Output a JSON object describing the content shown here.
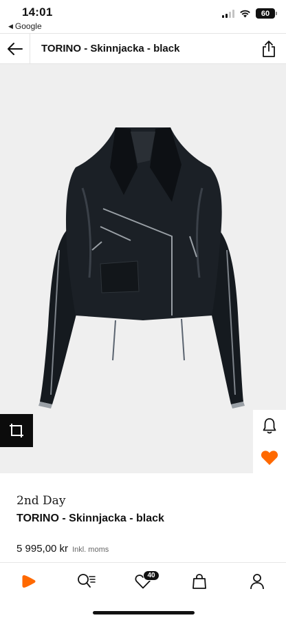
{
  "status_bar": {
    "time": "14:01",
    "back_app": "Google",
    "battery": "60"
  },
  "header": {
    "title": "TORINO - Skinnjacka - black",
    "back_icon": "arrow-left-icon",
    "share_icon": "share-icon"
  },
  "product": {
    "brand": "2nd Day",
    "name": "TORINO - Skinnjacka - black",
    "price": "5 995,00 kr",
    "price_note": "Inkl. moms",
    "image": "black-leather-biker-jacket"
  },
  "actions": {
    "zoom_icon": "expand-icon",
    "notify_icon": "bell-icon",
    "wishlist_icon": "heart-filled-icon"
  },
  "bottom_nav": {
    "items": [
      {
        "name": "home",
        "icon": "zalando-logo-icon"
      },
      {
        "name": "search",
        "icon": "search-list-icon"
      },
      {
        "name": "wishlist",
        "icon": "heart-icon",
        "badge": "40"
      },
      {
        "name": "bag",
        "icon": "bag-icon"
      },
      {
        "name": "profile",
        "icon": "person-icon"
      }
    ]
  },
  "colors": {
    "accent": "#ff6900",
    "text": "#111111",
    "image_bg": "#efefef",
    "divider": "#e4e4e4"
  }
}
